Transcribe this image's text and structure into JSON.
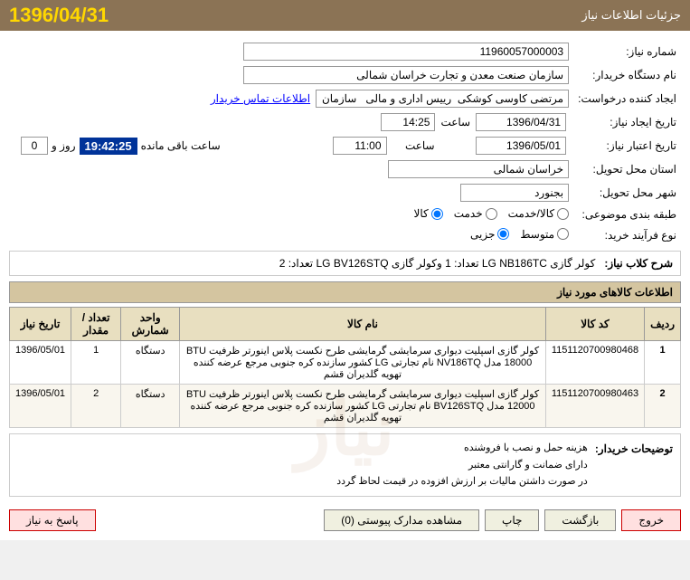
{
  "header": {
    "title": "جزئیات اطلاعات نیاز",
    "date": "1396/04/31"
  },
  "form": {
    "need_number_label": "شماره نیاز:",
    "need_number_value": "11960057000003",
    "buyer_name_label": "نام دستگاه خریدار:",
    "buyer_name_value": "سازمان صنعت معدن و تجارت خراسان شمالی",
    "creator_label": "ایجاد کننده درخواست:",
    "creator_value": "مرتضی کاوسی کوشکی  رییس اداری و مالی   سازمان صنعت معدن و تجارت خر",
    "creator_link": "اطلاعات تماس خریدار",
    "need_date_label": "تاریخ ایجاد نیاز:",
    "need_date_value": "1396/04/31",
    "need_time_label": "ساعت",
    "need_time_value": "14:25",
    "expiry_date_label": "تاریخ اعتبار نیاز:",
    "expiry_date_value": "1396/05/01",
    "expiry_time_value": "11:00",
    "expiry_time_label": "ساعت",
    "timer_label_day": "روز و",
    "timer_days": "0",
    "timer_time": "19:42:25",
    "timer_suffix": "ساعت باقی مانده",
    "province_label": "استان محل تحویل:",
    "province_value": "خراسان شمالی",
    "city_label": "شهر محل تحویل:",
    "city_value": "بجنورد",
    "category_label": "طبقه بندی موضوعی:",
    "category_options": [
      "کالا",
      "خدمت",
      "کالا/خدمت"
    ],
    "category_selected": "کالا",
    "process_label": "نوع فرآیند خرید:",
    "process_options": [
      "جزیی",
      "متوسط"
    ],
    "process_selected": "جزیی"
  },
  "klid": {
    "label": "شرح کلاب نیاز:",
    "text": "کولر گازی  LG NB186TC  تعداد: 1  وکولر گازی  LG BV126STQ  تعداد: 2"
  },
  "products_section": {
    "title": "اطلاعات کالاهای مورد نیاز",
    "columns": [
      "ردیف",
      "کد کالا",
      "نام کالا",
      "واحد شمارش",
      "تعداد / مقدار",
      "تاریخ نیاز"
    ],
    "rows": [
      {
        "index": "1",
        "code": "1151120700980468",
        "name": "کولر گازی اسپلیت دیواری سرمایشی گرمایشی طرح نکست پلاس اینورتر ظرفیت BTU 18000 مدل NV186TQ نام تجارتی LG کشور سازنده کره جنوبی مرجع عرضه کننده تهویه گلدیران قشم",
        "unit": "دستگاه",
        "quantity": "1",
        "date": "1396/05/01"
      },
      {
        "index": "2",
        "code": "1151120700980463",
        "name": "کولر گازی اسپلیت دیواری سرمایشی گرمایشی طرح نکست پلاس اینورتر ظرفیت BTU 12000 مدل BV126STQ نام تجارتی LG کشور سازنده کره جنوبی مرجع عرضه کننده تهویه گلدیران قشم",
        "unit": "دستگاه",
        "quantity": "2",
        "date": "1396/05/01"
      }
    ]
  },
  "notes": {
    "label": "توضیحات خریدار:",
    "lines": [
      "هزینه حمل و نصب با فروشنده",
      "دارای ضمانت و گارانتی معتبر",
      "در صورت داشتن مالیات بر ارزش افزوده در قیمت لحاظ گردد"
    ]
  },
  "buttons": {
    "answer": "پاسخ به نیاز",
    "view_docs": "مشاهده مدارک پیوستی (0)",
    "print": "چاپ",
    "back": "بازگشت",
    "exit": "خروج"
  }
}
